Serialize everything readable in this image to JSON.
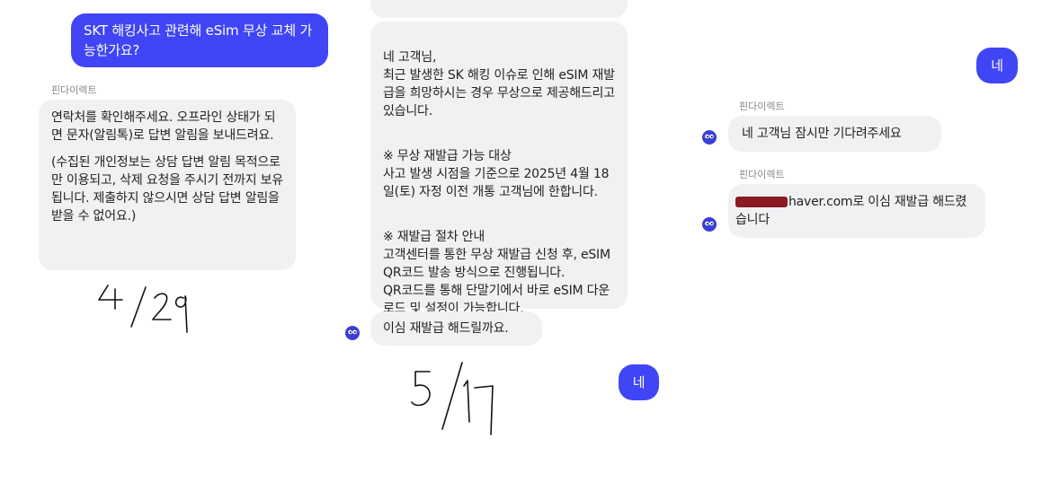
{
  "sender_name": "핀다이렉트",
  "panel1": {
    "user_question": "SKT 해킹사고 관련해 eSim 무상 교체 가능한가요?",
    "bot_p1": "연락처를 확인해주세요. 오프라인 상태가 되면 문자(알림톡)로 답변 알림을 보내드려요.",
    "bot_p2": "(수집된 개인정보는 상담 답변 알림 목적으로만 이용되고, 삭제 요청을 주시기 전까지 보유됩니다. 제출하지 않으시면 상담 답변 알림을 받을 수 없어요.)",
    "handwritten_date": "4/29"
  },
  "panel2": {
    "bot_p1": "네 고객님,\n최근 발생한 SK 해킹 이슈로 인해 eSIM 재발급을 희망하시는 경우 무상으로 제공해드리고 있습니다.",
    "bot_p2": "※ 무상 재발급 가능 대상\n사고 발생 시점을 기준으로 2025년 4월 18일(토) 자정 이전 개통 고객님에 한합니다.",
    "bot_p3": "※ 재발급 절차 안내\n고객센터를 통한 무상 재발급 신청 후, eSIM QR코드 발송 방식으로 진행됩니다.\nQR코드를 통해 단말기에서 바로 eSIM 다운로드 및 설정이 가능합니다.",
    "bot_question": "이심 재발급 해드릴까요.",
    "user_reply": "네",
    "handwritten_date": "5/17"
  },
  "panel3": {
    "user_reply": "네",
    "bot_wait": "네 고객님 잠시만 기다려주세요",
    "bot_done": "haver.com로 이심 재발급 해드렸습니다"
  },
  "colors": {
    "user_bubble": "#4045f5",
    "bot_bubble": "#f1f1f3",
    "avatar": "#3a3ed8",
    "redaction": "#8a1a22"
  }
}
